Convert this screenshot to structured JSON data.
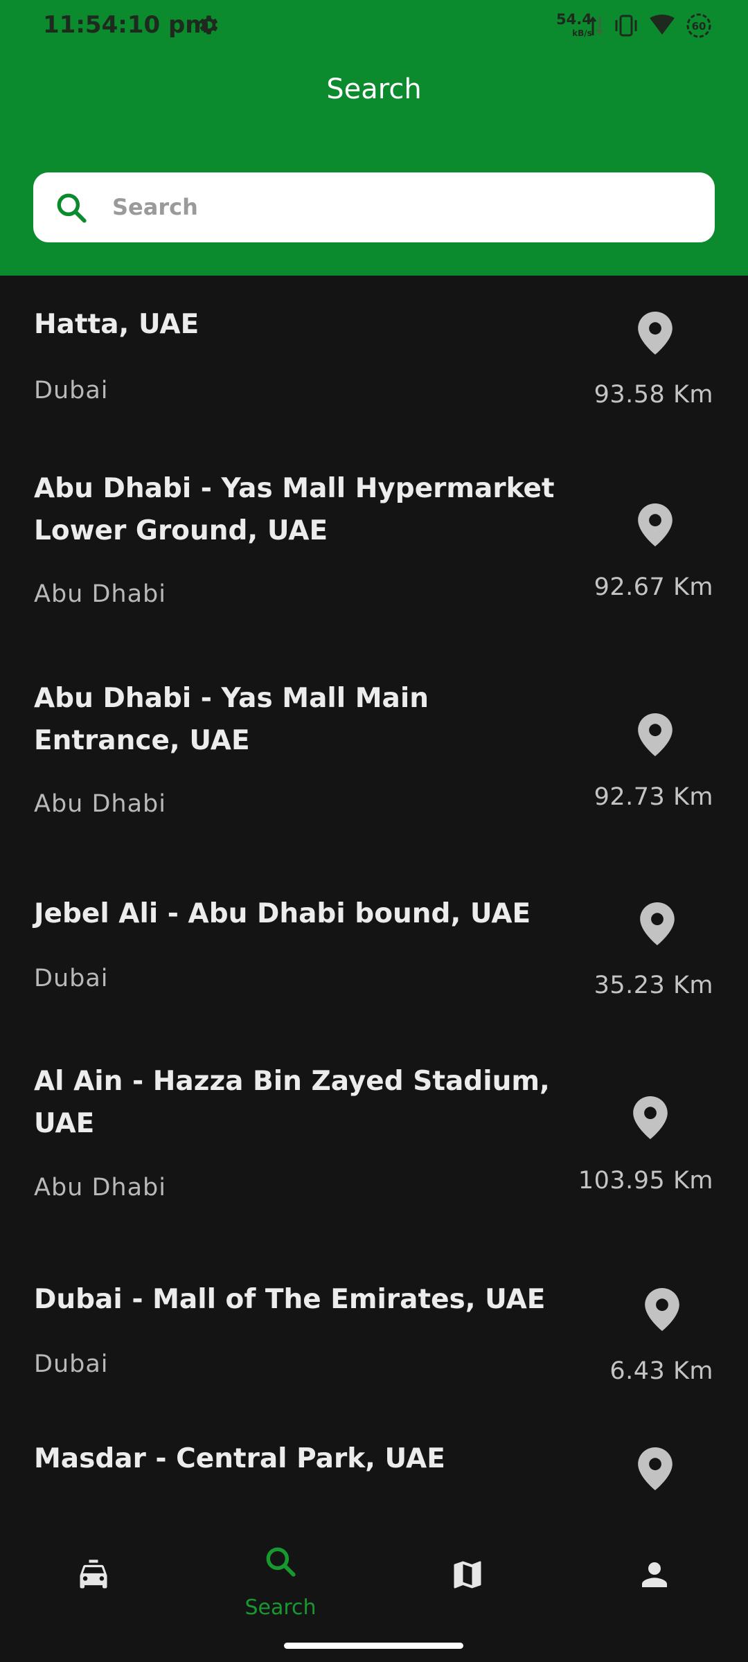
{
  "status_bar": {
    "time": "11:54:10 pm",
    "net_speed": "54.4",
    "net_unit": "kB/s",
    "battery": "60"
  },
  "header": {
    "title": "Search"
  },
  "search": {
    "placeholder": "Search",
    "value": ""
  },
  "locations": [
    {
      "title": "Hatta, UAE",
      "region": "Dubai",
      "distance": "93.58 Km"
    },
    {
      "title": "Abu Dhabi - Yas Mall Hypermarket Lower Ground, UAE",
      "region": "Abu Dhabi",
      "distance": "92.67 Km"
    },
    {
      "title": "Abu Dhabi - Yas Mall Main Entrance, UAE",
      "region": "Abu Dhabi",
      "distance": "92.73 Km"
    },
    {
      "title": "Jebel Ali - Abu Dhabi bound, UAE",
      "region": "Dubai",
      "distance": "35.23 Km"
    },
    {
      "title": "Al Ain - Hazza Bin Zayed Stadium, UAE",
      "region": "Abu Dhabi",
      "distance": "103.95 Km"
    },
    {
      "title": "Dubai - Mall of The Emirates, UAE",
      "region": "Dubai",
      "distance": "6.43 Km"
    },
    {
      "title": "Masdar - Central Park, UAE",
      "region": "",
      "distance": ""
    }
  ],
  "bottom_nav": {
    "items": [
      {
        "icon": "taxi-icon",
        "label": ""
      },
      {
        "icon": "search-icon",
        "label": "Search"
      },
      {
        "icon": "map-icon",
        "label": ""
      },
      {
        "icon": "profile-icon",
        "label": ""
      }
    ]
  },
  "colors": {
    "brand_green": "#0c8a2e",
    "active_nav": "#17992f",
    "background": "#141414"
  }
}
